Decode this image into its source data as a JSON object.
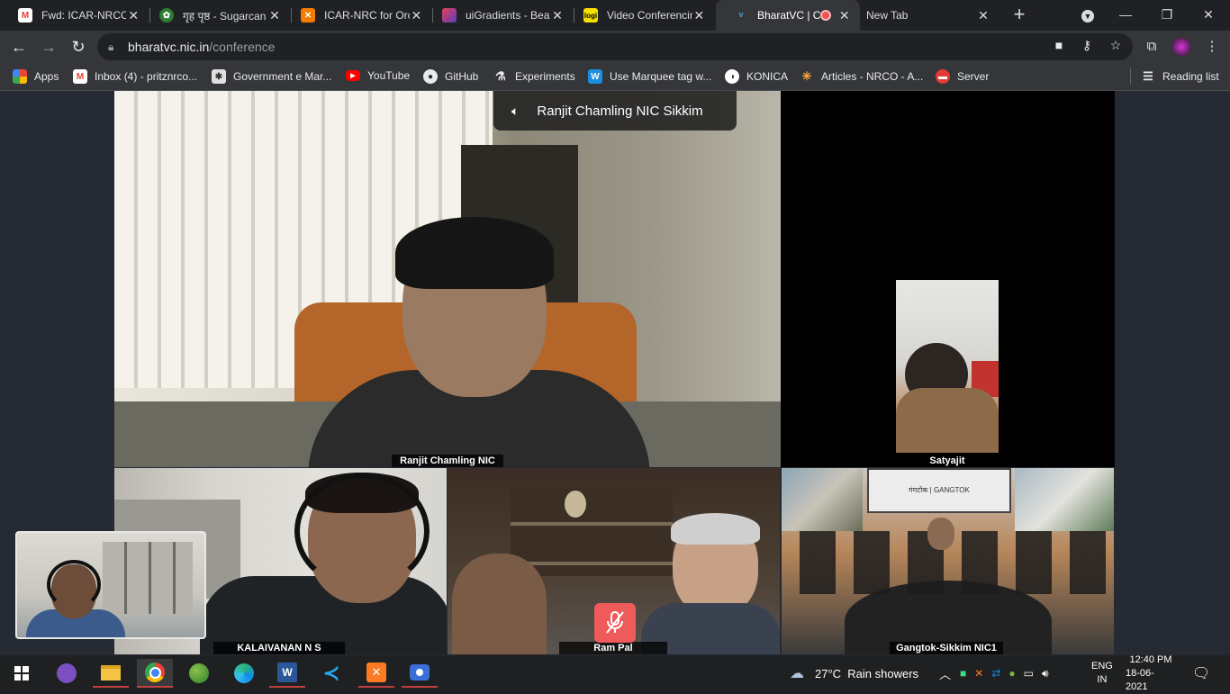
{
  "tabs": [
    {
      "title": "Fwd: ICAR-NRCO",
      "icon": "gmail-icon",
      "color": "#ea4335"
    },
    {
      "title": "गृह पृष्ठ - Sugarcan",
      "icon": "sugarcane-site-icon",
      "color": "#2e7d32"
    },
    {
      "title": "ICAR-NRC for Orc",
      "icon": "xampp-icon",
      "color": "#f57c00"
    },
    {
      "title": "uiGradients - Bea",
      "icon": "gradient-icon",
      "color": "#a23ba9"
    },
    {
      "title": "Video Conferencin",
      "icon": "logi-icon",
      "color": "#f5e100"
    },
    {
      "title": "BharatVC | Co",
      "icon": "bharatvc-icon",
      "color": "#4a9fd8"
    },
    {
      "title": "New Tab",
      "icon": "",
      "color": ""
    }
  ],
  "toolbar": {
    "url_host": "bharatvc.nic.in",
    "url_path": "/conference"
  },
  "bookmarks": [
    {
      "label": "Apps",
      "icon": "apps-grid-icon"
    },
    {
      "label": "Inbox (4) - pritznrco...",
      "icon": "gmail-icon"
    },
    {
      "label": "Government e Mar...",
      "icon": "gem-icon"
    },
    {
      "label": "YouTube",
      "icon": "youtube-icon"
    },
    {
      "label": "GitHub",
      "icon": "github-icon"
    },
    {
      "label": "Experiments",
      "icon": "flask-icon"
    },
    {
      "label": "Use Marquee tag w...",
      "icon": "w-icon"
    },
    {
      "label": "KONICA",
      "icon": "konica-icon"
    },
    {
      "label": "Articles - NRCO - A...",
      "icon": "joomla-icon"
    },
    {
      "label": "Server",
      "icon": "server-icon"
    }
  ],
  "reading_list": "Reading list",
  "conference": {
    "active_speaker": "Ranjit Chamling NIC Sikkim",
    "participants": [
      {
        "name": "Ranjit Chamling NIC"
      },
      {
        "name": "Satyajit"
      },
      {
        "name": "KALAIVANAN N S"
      },
      {
        "name": "Ram Pal"
      },
      {
        "name": "Gangtok-Sikkim NIC1"
      }
    ],
    "sign_text": "गंगटोक | GANGTOK"
  },
  "taskbar": {
    "weather": "27°C  Rain showers",
    "lang_top": "ENG",
    "lang_bottom": "IN",
    "time": "12:40 PM",
    "date": "18-06-2021"
  }
}
